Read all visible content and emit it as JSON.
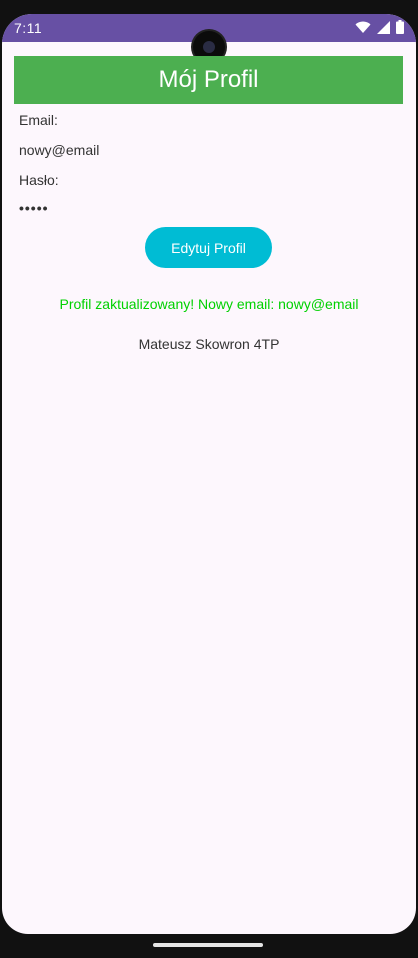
{
  "status_bar": {
    "time": "7:11",
    "icons": [
      "wifi-icon",
      "signal-icon",
      "battery-icon"
    ],
    "color": "#6750a4"
  },
  "header": {
    "title": "Mój Profil",
    "color": "#4caf50"
  },
  "profile": {
    "email_label": "Email:",
    "email_value": "nowy@email",
    "password_label": "Hasło:",
    "password_value": "•••••"
  },
  "actions": {
    "edit_label": "Edytuj Profil",
    "button_color": "#00bcd4"
  },
  "messages": {
    "status": "Profil zaktualizowany! Nowy email: nowy@email",
    "status_color": "#00d100",
    "author": "Mateusz Skowron 4TP"
  }
}
